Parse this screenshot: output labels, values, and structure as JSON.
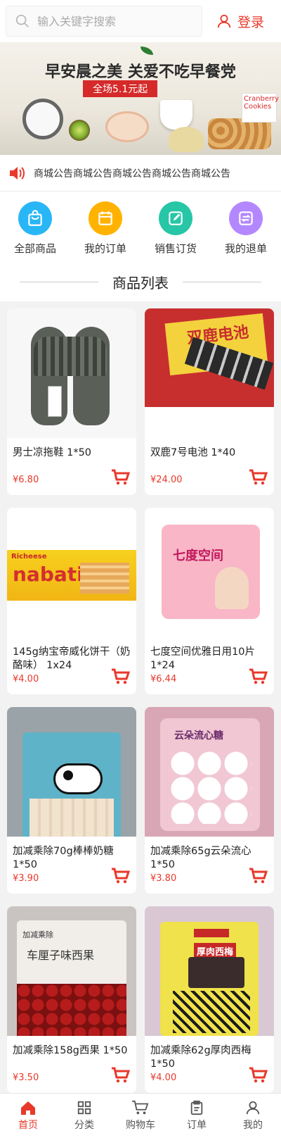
{
  "header": {
    "search_placeholder": "输入关键字搜索",
    "login_label": "登录"
  },
  "banner": {
    "headline": "早安晨之美 关爱不吃早餐党",
    "promo": "全场5.1元起",
    "box_text": "Cranberry Cookies"
  },
  "notice": {
    "text": "商城公告商城公告商城公告商城公告商城公告"
  },
  "quick_menu": [
    {
      "label": "全部商品",
      "color": "#29b6f6",
      "icon": "shopping-bag-icon"
    },
    {
      "label": "我的订单",
      "color": "#ffb300",
      "icon": "calendar-icon"
    },
    {
      "label": "销售订货",
      "color": "#26c6a6",
      "icon": "edit-icon"
    },
    {
      "label": "我的退单",
      "color": "#b388ff",
      "icon": "exchange-icon"
    }
  ],
  "section": {
    "title": "商品列表"
  },
  "products": [
    {
      "name": "男士凉拖鞋 1*50",
      "price": "¥6.80"
    },
    {
      "name": "双鹿7号电池 1*40",
      "price": "¥24.00"
    },
    {
      "name": "145g纳宝帝威化饼干（奶酪味） 1x24",
      "price": "¥4.00"
    },
    {
      "name": "七度空间优雅日用10片 1*24",
      "price": "¥6.44"
    },
    {
      "name": "加减乘除70g棒棒奶糖 1*50",
      "price": "¥3.90"
    },
    {
      "name": "加减乘除65g云朵流心 1*50",
      "price": "¥3.80"
    },
    {
      "name": "加减乘除158g西果 1*50",
      "price": "¥3.50"
    },
    {
      "name": "加减乘除62g厚肉西梅 1*50",
      "price": "¥4.00"
    }
  ],
  "product_images": {
    "p1": {
      "label": ""
    },
    "p2": {
      "label": "双鹿电池"
    },
    "p3": {
      "label": "nabati",
      "sub": "Richeese"
    },
    "p4": {
      "label": "七度空间"
    },
    "p5": {
      "label": ""
    },
    "p6": {
      "label": "云朵流心糖"
    },
    "p7": {
      "label": "车厘子味西果",
      "sub": "加减乘除"
    },
    "p8": {
      "label": "厚肉西梅"
    }
  },
  "tabbar": [
    {
      "label": "首页",
      "icon": "home-icon",
      "active": true
    },
    {
      "label": "分类",
      "icon": "grid-icon",
      "active": false
    },
    {
      "label": "购物车",
      "icon": "cart-icon",
      "active": false
    },
    {
      "label": "订单",
      "icon": "clipboard-icon",
      "active": false
    },
    {
      "label": "我的",
      "icon": "user-icon",
      "active": false
    }
  ],
  "colors": {
    "accent": "#e8392b"
  }
}
